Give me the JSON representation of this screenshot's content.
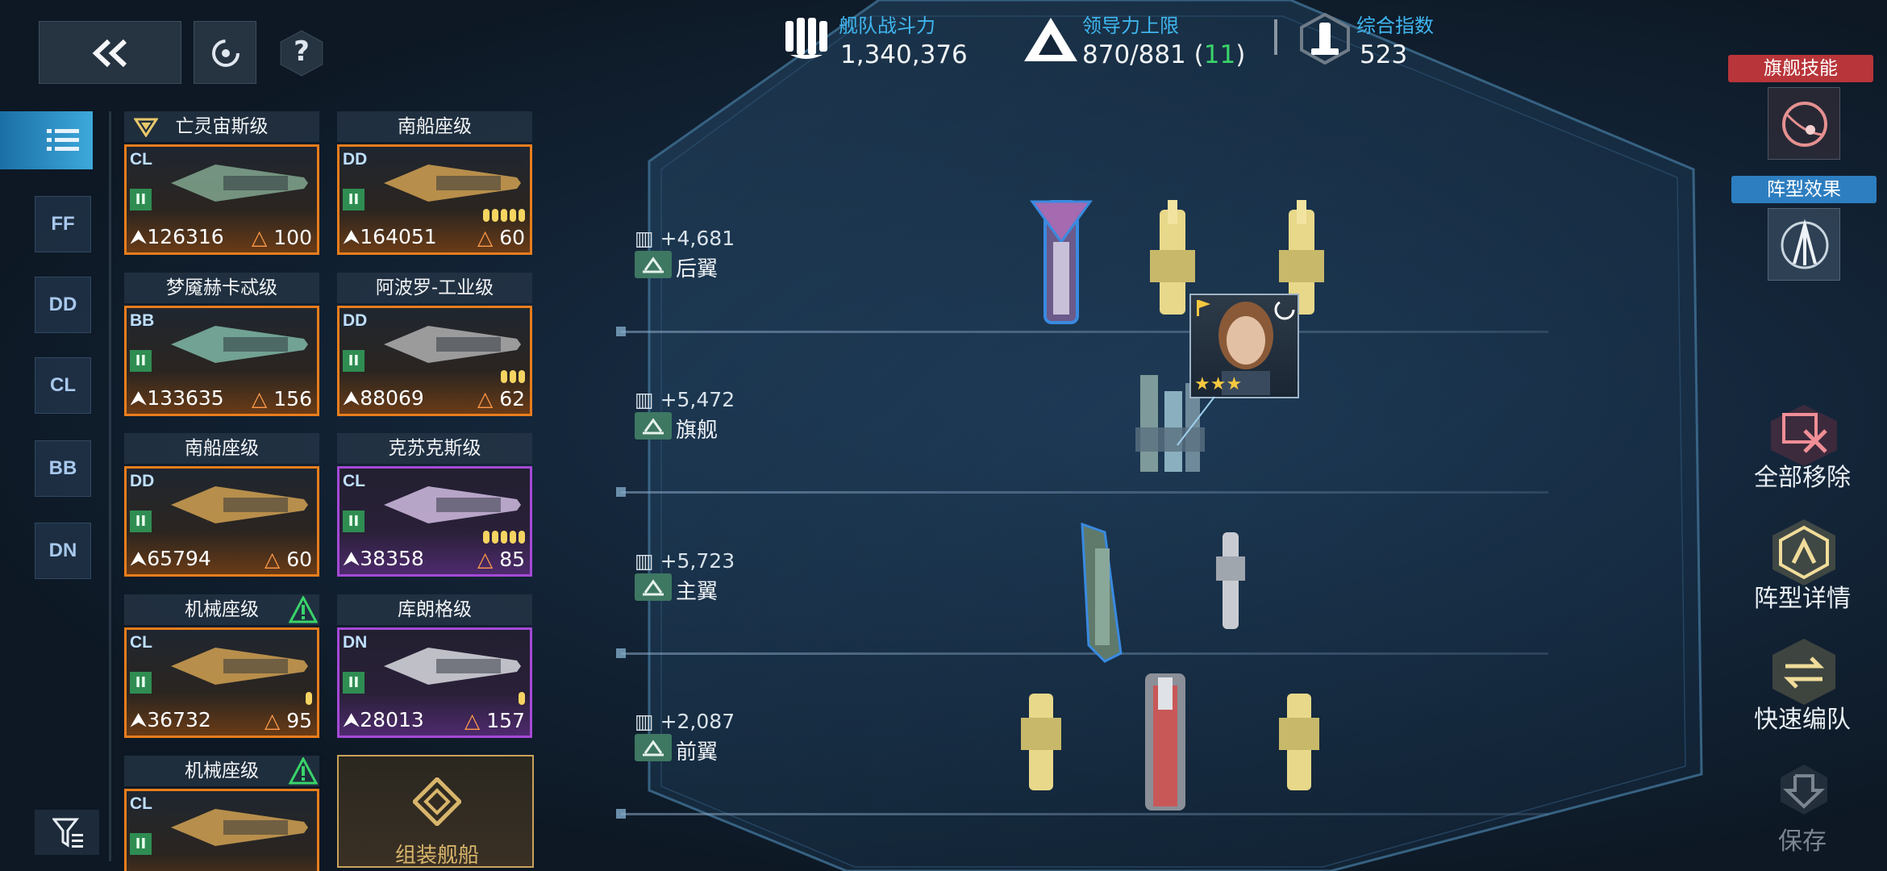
{
  "top_bar": {
    "back_icon": "double-chevron-left-icon",
    "refresh_icon": "refresh-icon",
    "help_label": "?"
  },
  "stats": {
    "fleet_power_label": "舰队战斗力",
    "fleet_power_value": "1,340,376",
    "command_limit_label": "领导力上限",
    "command_limit_value": "870/881 (",
    "command_limit_extra": "11",
    "command_limit_close": ")",
    "overall_index_label": "综合指数",
    "overall_index_value": "523"
  },
  "filter_rail": {
    "items": [
      {
        "code": "FF",
        "icon": "frigate-class-icon"
      },
      {
        "code": "DD",
        "icon": "destroyer-class-icon"
      },
      {
        "code": "CL",
        "icon": "light-cruiser-class-icon"
      },
      {
        "code": "BB",
        "icon": "battleship-class-icon"
      },
      {
        "code": "DN",
        "icon": "dreadnought-class-icon"
      }
    ],
    "list_icon": "list-icon",
    "filter_icon": "filter-icon"
  },
  "ship_cards": [
    {
      "name": "亡灵宙斯级",
      "cls": "CL",
      "tier": "II",
      "power": "126316",
      "cost": "100",
      "rarity": "orange",
      "levels": 0,
      "flagship": true,
      "warn": false
    },
    {
      "name": "南船座级",
      "cls": "DD",
      "tier": "II",
      "power": "164051",
      "cost": "60",
      "rarity": "orange",
      "levels": 5,
      "flagship": false,
      "warn": false
    },
    {
      "name": "梦魇赫卡忒级",
      "cls": "BB",
      "tier": "II",
      "power": "133635",
      "cost": "156",
      "rarity": "orange",
      "levels": 0,
      "flagship": false,
      "warn": false
    },
    {
      "name": "阿波罗-工业级",
      "cls": "DD",
      "tier": "II",
      "power": "88069",
      "cost": "62",
      "rarity": "orange",
      "levels": 3,
      "flagship": false,
      "warn": false
    },
    {
      "name": "南船座级",
      "cls": "DD",
      "tier": "II",
      "power": "65794",
      "cost": "60",
      "rarity": "orange",
      "levels": 0,
      "flagship": false,
      "warn": false
    },
    {
      "name": "克苏克斯级",
      "cls": "CL",
      "tier": "II",
      "power": "38358",
      "cost": "85",
      "rarity": "purple",
      "levels": 5,
      "flagship": false,
      "warn": false
    },
    {
      "name": "机械座级",
      "cls": "CL",
      "tier": "II",
      "power": "36732",
      "cost": "95",
      "rarity": "orange",
      "levels": 1,
      "flagship": false,
      "warn": true
    },
    {
      "name": "库朗格级",
      "cls": "DN",
      "tier": "II",
      "power": "28013",
      "cost": "157",
      "rarity": "purple",
      "levels": 1,
      "flagship": false,
      "warn": false
    },
    {
      "name": "机械座级",
      "cls": "CL",
      "tier": "II",
      "power": "",
      "cost": "",
      "rarity": "orange",
      "levels": 0,
      "flagship": false,
      "warn": true
    }
  ],
  "assemble_label": "组装舰船",
  "formation_rows": [
    {
      "bonus": "+4,681",
      "name": "后翼",
      "badge_icon": "rear-wing-icon"
    },
    {
      "bonus": "+5,472",
      "name": "旗舰",
      "badge_icon": "flagship-icon"
    },
    {
      "bonus": "+5,723",
      "name": "主翼",
      "badge_icon": "main-wing-icon"
    },
    {
      "bonus": "+2,087",
      "name": "前翼",
      "badge_icon": "front-wing-icon"
    }
  ],
  "commander": {
    "stars": "★★★",
    "icon": "commander-portrait"
  },
  "right_panel": {
    "flagship_skill_label": "旗舰技能",
    "formation_effect_label": "阵型效果",
    "remove_all_label": "全部移除",
    "formation_detail_label": "阵型详情",
    "quick_form_label": "快速编队",
    "save_label": "保存"
  },
  "colors": {
    "accent_blue": "#3fb6ee",
    "orange_rarity": "#e87d1c",
    "purple_rarity": "#a549d6",
    "skill_red": "#c0363c",
    "effect_blue": "#2d7ec0",
    "green": "#3ad46a"
  }
}
